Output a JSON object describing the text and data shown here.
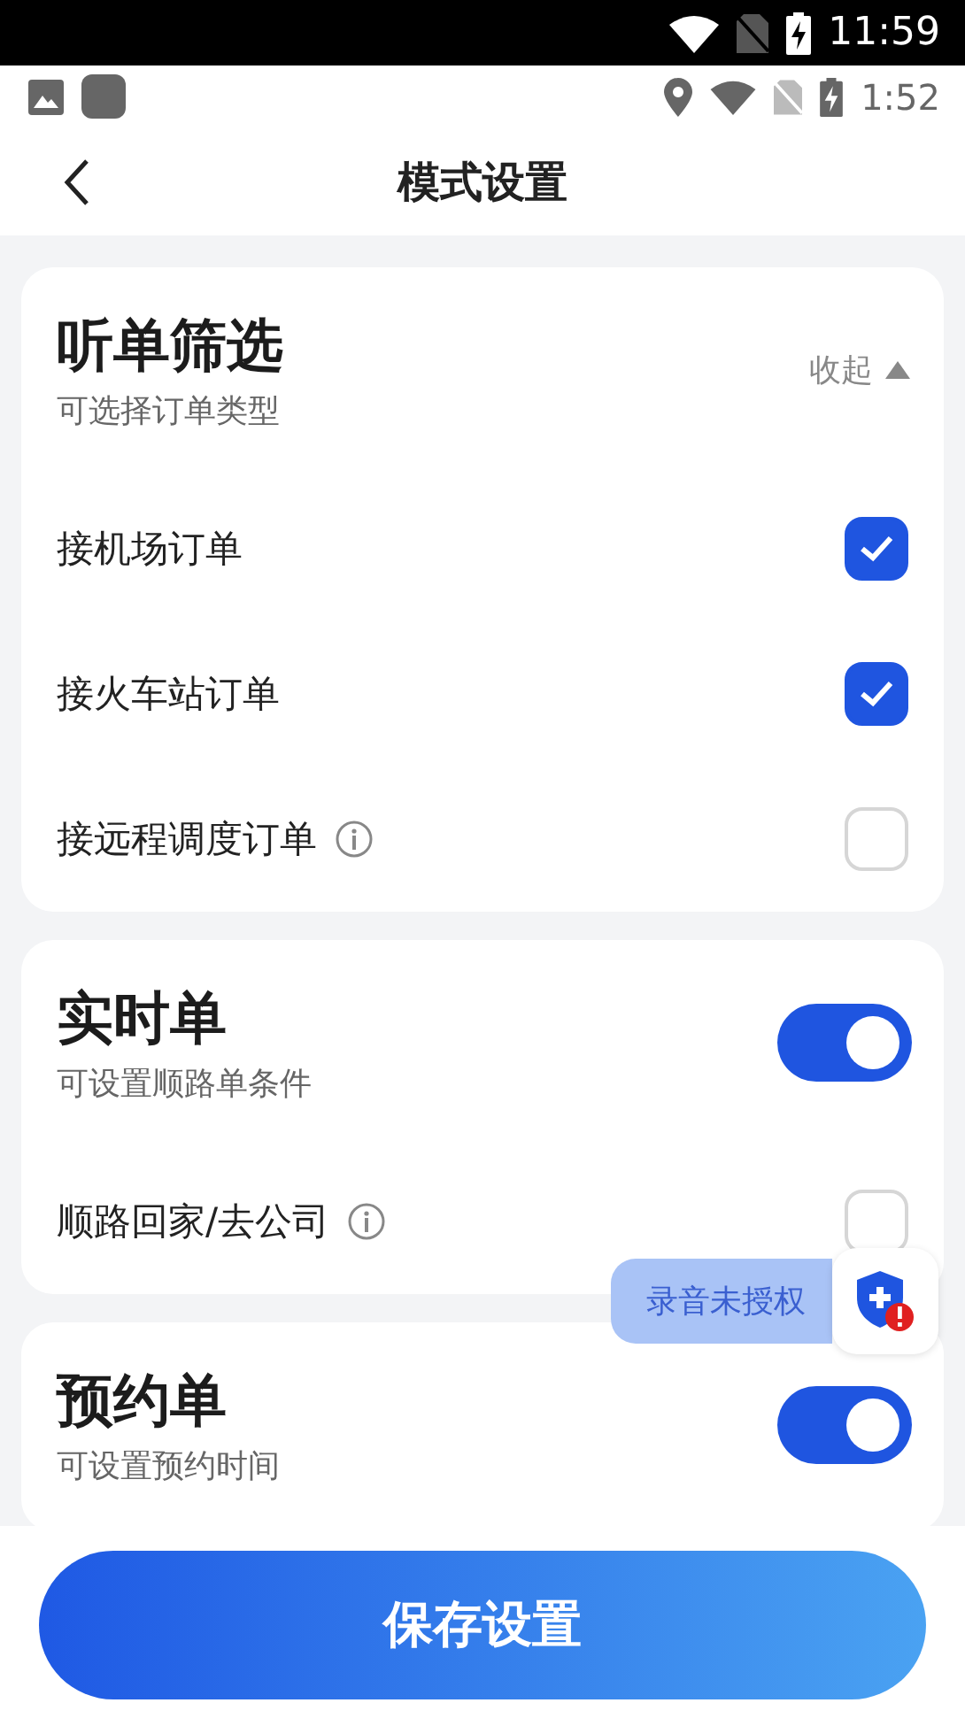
{
  "system_status": {
    "time": "11:59"
  },
  "app_status": {
    "time": "1:52"
  },
  "header": {
    "title": "模式设置"
  },
  "sections": [
    {
      "title": "听单筛选",
      "subtitle": "可选择订单类型",
      "control": {
        "kind": "collapse",
        "label": "收起",
        "expanded": true
      },
      "rows": [
        {
          "label": "接机场订单",
          "info": false,
          "checked": true
        },
        {
          "label": "接火车站订单",
          "info": false,
          "checked": true
        },
        {
          "label": "接远程调度订单",
          "info": true,
          "checked": false
        }
      ]
    },
    {
      "title": "实时单",
      "subtitle": "可设置顺路单条件",
      "control": {
        "kind": "switch",
        "on": true
      },
      "rows": [
        {
          "label": "顺路回家/去公司",
          "info": true,
          "checked": false
        }
      ]
    },
    {
      "title": "预约单",
      "subtitle": "可设置预约时间",
      "control": {
        "kind": "switch",
        "on": true
      }
    }
  ],
  "float_badge": {
    "label": "录音未授权",
    "alert": true
  },
  "save_button": {
    "label": "保存设置"
  }
}
